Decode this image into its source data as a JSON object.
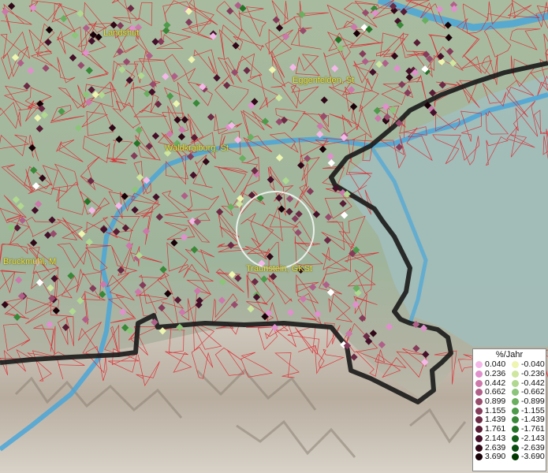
{
  "map": {
    "cities": [
      {
        "name": "Landshut"
      },
      {
        "name": "Eggenfelden, St"
      },
      {
        "name": "Waldkraiburg, St"
      },
      {
        "name": "Bruckmühl, M"
      },
      {
        "name": "Traunstein, GKSt"
      }
    ],
    "colors": {
      "positive": [
        "#f4b8e8",
        "#e090cc",
        "#cc78aa",
        "#b06088",
        "#984c6c",
        "#843c5a",
        "#6c2a44",
        "#581c34",
        "#44102a",
        "#300818",
        "#180008"
      ],
      "negative": [
        "#eef5b0",
        "#cfe6a0",
        "#b0d890",
        "#8cc47a",
        "#6aae60",
        "#4c9a4a",
        "#388838",
        "#247428",
        "#14601a",
        "#084c10",
        "#003800"
      ],
      "border": "#1a1a1a",
      "municipal_lines": "#e0202a",
      "river": "#4aa6d8"
    }
  },
  "legend": {
    "title": "%/Jahr",
    "positive": [
      "0.040",
      "0.236",
      "0.442",
      "0.662",
      "0.899",
      "1.155",
      "1.439",
      "1.761",
      "2.143",
      "2.639",
      "3.690"
    ],
    "negative": [
      "-0.040",
      "-0.236",
      "-0.442",
      "-0.662",
      "-0.899",
      "-1.155",
      "-1.439",
      "-1.761",
      "-2.143",
      "-2.639",
      "-3.690"
    ]
  }
}
